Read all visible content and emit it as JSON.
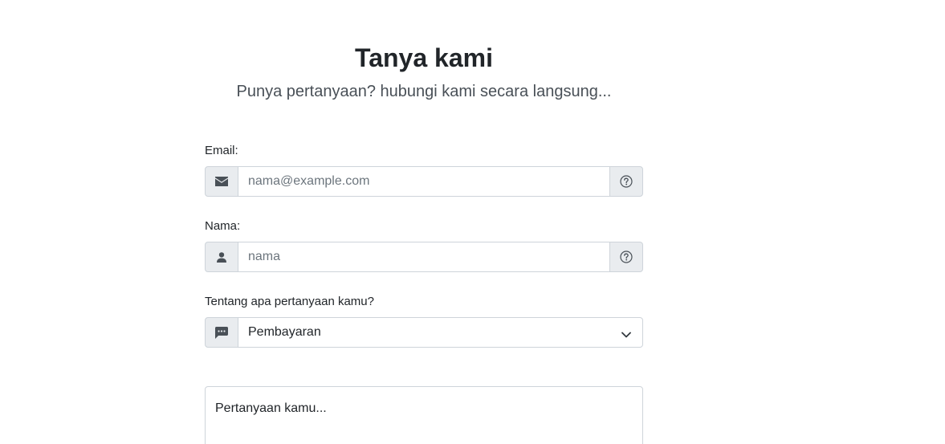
{
  "header": {
    "title": "Tanya kami",
    "subtitle": "Punya pertanyaan? hubungi kami secara langsung..."
  },
  "form": {
    "email": {
      "label": "Email:",
      "placeholder": "nama@example.com",
      "value": "",
      "icon": "envelope-icon",
      "help_icon": "question-circle-icon"
    },
    "name": {
      "label": "Nama:",
      "placeholder": "nama",
      "value": "",
      "icon": "person-icon",
      "help_icon": "question-circle-icon"
    },
    "topic": {
      "label": "Tentang apa pertanyaan kamu?",
      "selected": "Pembayaran",
      "icon": "chat-bubble-icon"
    },
    "question": {
      "placeholder": "Pertanyaan kamu..."
    }
  },
  "colors": {
    "addon_bg": "#e9ecef",
    "border": "#ced4da",
    "text": "#212529",
    "placeholder": "#6c757d"
  }
}
